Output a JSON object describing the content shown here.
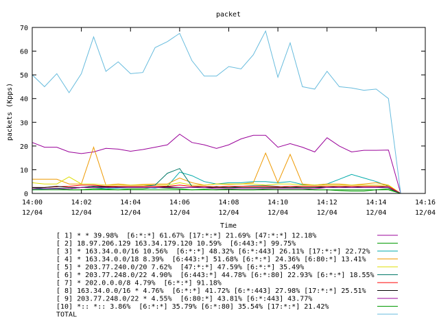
{
  "chart_data": {
    "type": "line",
    "title": "packet",
    "xlabel": "Time",
    "ylabel": "packets (Kpps)",
    "ylim": [
      0,
      70
    ],
    "yticks": [
      0,
      10,
      20,
      30,
      40,
      50,
      60,
      70
    ],
    "xlim": [
      "14:00",
      "14:16"
    ],
    "xticks": [
      {
        "time": "14:00",
        "date": "12/04"
      },
      {
        "time": "14:02",
        "date": "12/04"
      },
      {
        "time": "14:04",
        "date": "12/04"
      },
      {
        "time": "14:06",
        "date": "12/04"
      },
      {
        "time": "14:08",
        "date": "12/04"
      },
      {
        "time": "14:10",
        "date": "12/04"
      },
      {
        "time": "14:12",
        "date": "12/04"
      },
      {
        "time": "14:14",
        "date": "12/04"
      },
      {
        "time": "14:16",
        "date": "12/04"
      }
    ],
    "grid": false,
    "legend_position": "bottom",
    "x": [
      "14:00:00",
      "14:00:30",
      "14:01:00",
      "14:01:30",
      "14:02:00",
      "14:02:30",
      "14:03:00",
      "14:03:30",
      "14:04:00",
      "14:04:30",
      "14:05:00",
      "14:05:30",
      "14:06:00",
      "14:06:30",
      "14:07:00",
      "14:07:30",
      "14:08:00",
      "14:08:30",
      "14:09:00",
      "14:09:30",
      "14:10:00",
      "14:10:30",
      "14:11:00",
      "14:11:30",
      "14:12:00",
      "14:12:30",
      "14:13:00",
      "14:13:30",
      "14:14:00",
      "14:14:30",
      "14:15:00"
    ],
    "series": [
      {
        "name": "[ 1] * * 39.98%  [6:*:*] 61.67% [17:*:*] 21.69% [47:*:*] 12.18%",
        "color": "#990099",
        "values": [
          21.5,
          19.5,
          19.5,
          17.5,
          16.8,
          17.5,
          19,
          18.7,
          17.8,
          18.5,
          19.5,
          20.5,
          25,
          21.5,
          20.5,
          19,
          20.5,
          23,
          24.5,
          24.5,
          19.5,
          21,
          19.5,
          17.5,
          23.5,
          20,
          17.5,
          18.2,
          18.2,
          18.3,
          0
        ]
      },
      {
        "name": "[ 2] 18.97.206.129 163.34.179.120 10.59%  [6:443:*] 99.75%",
        "color": "#009900",
        "values": [
          2,
          2,
          2,
          1.5,
          1.5,
          2,
          1.8,
          1.5,
          2,
          2,
          2.5,
          2.2,
          2,
          1.5,
          1.8,
          1.5,
          1.8,
          1.5,
          1.5,
          1.8,
          2,
          2,
          2,
          1.5,
          1.5,
          1.2,
          1,
          1,
          1.5,
          2,
          0
        ]
      },
      {
        "name": "[ 3] * 163.34.0.0/16 10.56%  [6:*:*] 48.32% [6:*:443] 26.11% [17:*:*] 22.72%",
        "color": "#00aaaa",
        "values": [
          1.5,
          1.8,
          2,
          2,
          2.5,
          2.5,
          2,
          2.2,
          2.5,
          2.5,
          2.2,
          3,
          9,
          7.5,
          5,
          4,
          4.5,
          4.5,
          5,
          5,
          4.5,
          5,
          3.8,
          3.5,
          4,
          6,
          8,
          6.5,
          5,
          3,
          0
        ]
      },
      {
        "name": "[ 4] * 163.34.0.0/18 8.39%  [6:443:*] 51.68% [6:*:*] 24.36% [6:80:*] 13.41%",
        "color": "#ee9900",
        "values": [
          6,
          6,
          6,
          4,
          4,
          19.5,
          3.5,
          4,
          3.5,
          3.8,
          4,
          4,
          6.5,
          4.5,
          3.5,
          4,
          3.8,
          4,
          4.5,
          17,
          4.5,
          16.5,
          4,
          3.5,
          4,
          4,
          3.5,
          4,
          4.5,
          3.5,
          0
        ]
      },
      {
        "name": "[ 5] * 203.77.240.0/20 7.62%  [47:*:*] 47.59% [6:*:*] 35.49%",
        "color": "#dddd00",
        "values": [
          4.5,
          4,
          4,
          7,
          4,
          4,
          3.5,
          3.5,
          3.5,
          3.5,
          3.5,
          3.5,
          4.5,
          3.5,
          3.5,
          4,
          4,
          4,
          4,
          3.5,
          4,
          4,
          3.5,
          3.5,
          3.5,
          3.5,
          3.5,
          3.5,
          3.5,
          3.5,
          0
        ]
      },
      {
        "name": "[ 6] * 203.77.248.0/22 4.90%  [6:443:*] 44.78% [6:*:80] 22.93% [6:*:*] 18.55%",
        "color": "#007766",
        "values": [
          2.5,
          2,
          2.2,
          2,
          2.5,
          3,
          2.5,
          2.8,
          3,
          3,
          3.5,
          8.5,
          10.5,
          3,
          2.5,
          3,
          2.5,
          3,
          3.2,
          3.2,
          3,
          2.5,
          3,
          3,
          2.5,
          3,
          2.5,
          3,
          3,
          2.5,
          0
        ]
      },
      {
        "name": "[ 7] * 202.0.0.0/8 4.79%  [6:*:*] 91.18%",
        "color": "#ff0000",
        "values": [
          2.5,
          2.5,
          2.8,
          3,
          3.5,
          3.5,
          3,
          3,
          3,
          3,
          3,
          3,
          3.5,
          3,
          3,
          2.8,
          3,
          3,
          3,
          3,
          2.8,
          3,
          3,
          3,
          3,
          3,
          3,
          3,
          3,
          3,
          0
        ]
      },
      {
        "name": "[ 8] 163.34.0.0/16 * 4.76%  [6:*:*] 41.72% [6:*:443] 27.98% [17:*:*] 25.51%",
        "color": "#000000",
        "values": [
          2.5,
          2.5,
          3,
          2.5,
          2.5,
          3,
          2.8,
          2.5,
          2.5,
          2.5,
          2.5,
          2.8,
          2.5,
          2.5,
          2.5,
          2.5,
          2.5,
          2.5,
          2.5,
          2.5,
          2.5,
          2.5,
          2.5,
          2.5,
          2.5,
          2.5,
          2.5,
          2.5,
          2.5,
          2.5,
          0
        ]
      },
      {
        "name": "[ 9] 203.77.248.0/22 * 4.55%  [6:80:*] 43.81% [6:*:443] 43.77%",
        "color": "#990099",
        "values": [
          2,
          2,
          2,
          2,
          2.5,
          2.5,
          2.5,
          2.5,
          2.5,
          2.5,
          2.5,
          2.5,
          2.5,
          2.5,
          2.5,
          2,
          2,
          2,
          2,
          2,
          2,
          2,
          2,
          2,
          2.5,
          2.5,
          2.5,
          2.5,
          2.5,
          2.5,
          0
        ]
      },
      {
        "name": "[10] *:: *:: 3.86%  [6:*:*] 35.79% [6:*:80] 35.54% [17:*:*] 21.42%",
        "color": "#009900",
        "values": [
          1.5,
          1.5,
          1.5,
          1.5,
          1.5,
          1.5,
          1.5,
          1.5,
          1.5,
          1.5,
          1.5,
          1.5,
          1.5,
          1.5,
          1.5,
          1.5,
          1.5,
          1.5,
          1.5,
          1.5,
          1.5,
          1.5,
          1.5,
          1.5,
          1.5,
          1.5,
          1.5,
          1.5,
          1.5,
          1.5,
          0
        ]
      },
      {
        "name": "TOTAL",
        "color": "#66bbdd",
        "values": [
          50,
          45,
          50.5,
          42.5,
          50.5,
          66,
          51.5,
          55.5,
          50.5,
          51,
          61.5,
          64,
          67.5,
          56,
          49.5,
          49.5,
          53.5,
          52.5,
          58.5,
          68.5,
          49,
          63.5,
          45,
          44,
          51.5,
          45,
          44.5,
          43.5,
          44,
          40,
          0
        ]
      }
    ]
  }
}
